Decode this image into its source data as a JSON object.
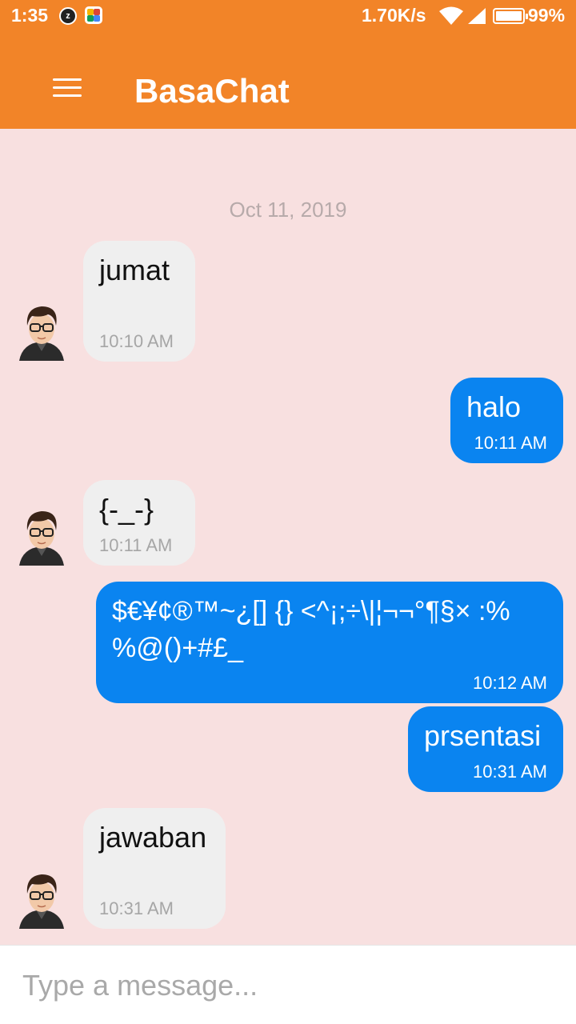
{
  "status_bar": {
    "time": "1:35",
    "net_speed": "1.70K/s",
    "battery": "99%",
    "icons": [
      "z-app-icon",
      "colorful-app-icon",
      "wifi-icon",
      "signal-icon",
      "battery-icon"
    ]
  },
  "app_bar": {
    "title": "BasaChat",
    "menu_icon": "hamburger-menu-icon",
    "color": "#f28428"
  },
  "chat": {
    "background": "#f8e0e0",
    "date_separator": "Oct 11, 2019",
    "messages": [
      {
        "direction": "in",
        "text": "jumat",
        "time": "10:10 AM"
      },
      {
        "direction": "out",
        "text": "halo",
        "time": "10:11 AM"
      },
      {
        "direction": "in",
        "text": "{-_-}",
        "time": "10:11 AM"
      },
      {
        "direction": "out",
        "text": "$€¥¢®™~¿[] {} <^¡;÷\\|¦¬¬°¶§× :%",
        "text2": "%@()+#£_",
        "time": "10:12 AM"
      },
      {
        "direction": "out",
        "text": "prsentasi",
        "time": "10:31 AM"
      },
      {
        "direction": "in",
        "text": "jawaban",
        "time": "10:31 AM"
      }
    ],
    "incoming_color": "#efefef",
    "outgoing_color": "#0a84f0"
  },
  "composer": {
    "placeholder": "Type a message...",
    "value": ""
  }
}
